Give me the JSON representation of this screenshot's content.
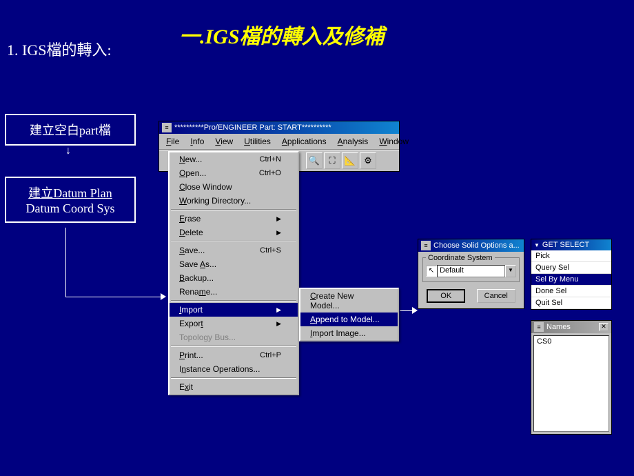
{
  "slide": {
    "title": "一.IGS檔的轉入及修補",
    "subtitle": "1. IGS檔的轉入:",
    "step1": "建立空白part檔",
    "step2_line1": "建立Datum Plan",
    "step2_line2": "Datum Coord Sys"
  },
  "proe": {
    "window_title": "**********Pro/ENGINEER Part: START**********",
    "menus": {
      "file": "File",
      "info": "Info",
      "view": "View",
      "utilities": "Utilities",
      "applications": "Applications",
      "analysis": "Analysis",
      "window": "Window"
    }
  },
  "file_menu": {
    "new": "New...",
    "new_sc": "Ctrl+N",
    "open": "Open...",
    "open_sc": "Ctrl+O",
    "close": "Close Window",
    "workingdir": "Working Directory...",
    "erase": "Erase",
    "delete": "Delete",
    "save": "Save...",
    "save_sc": "Ctrl+S",
    "saveas": "Save As...",
    "backup": "Backup...",
    "rename": "Rename...",
    "import": "Import",
    "export": "Export",
    "topology": "Topology Bus...",
    "print": "Print...",
    "print_sc": "Ctrl+P",
    "instance": "Instance Operations...",
    "exit": "Exit"
  },
  "import_submenu": {
    "create": "Create New Model...",
    "append": "Append to Model...",
    "image": "Import Image..."
  },
  "choose_dialog": {
    "title": "Choose Solid Options a...",
    "group": "Coordinate System",
    "value": "Default",
    "ok": "OK",
    "cancel": "Cancel"
  },
  "getselect": {
    "title": "GET SELECT",
    "pick": "Pick",
    "query": "Query Sel",
    "selbymenu": "Sel By Menu",
    "done": "Done Sel",
    "quit": "Quit Sel"
  },
  "names_panel": {
    "title": "Names",
    "item0": "CS0"
  }
}
